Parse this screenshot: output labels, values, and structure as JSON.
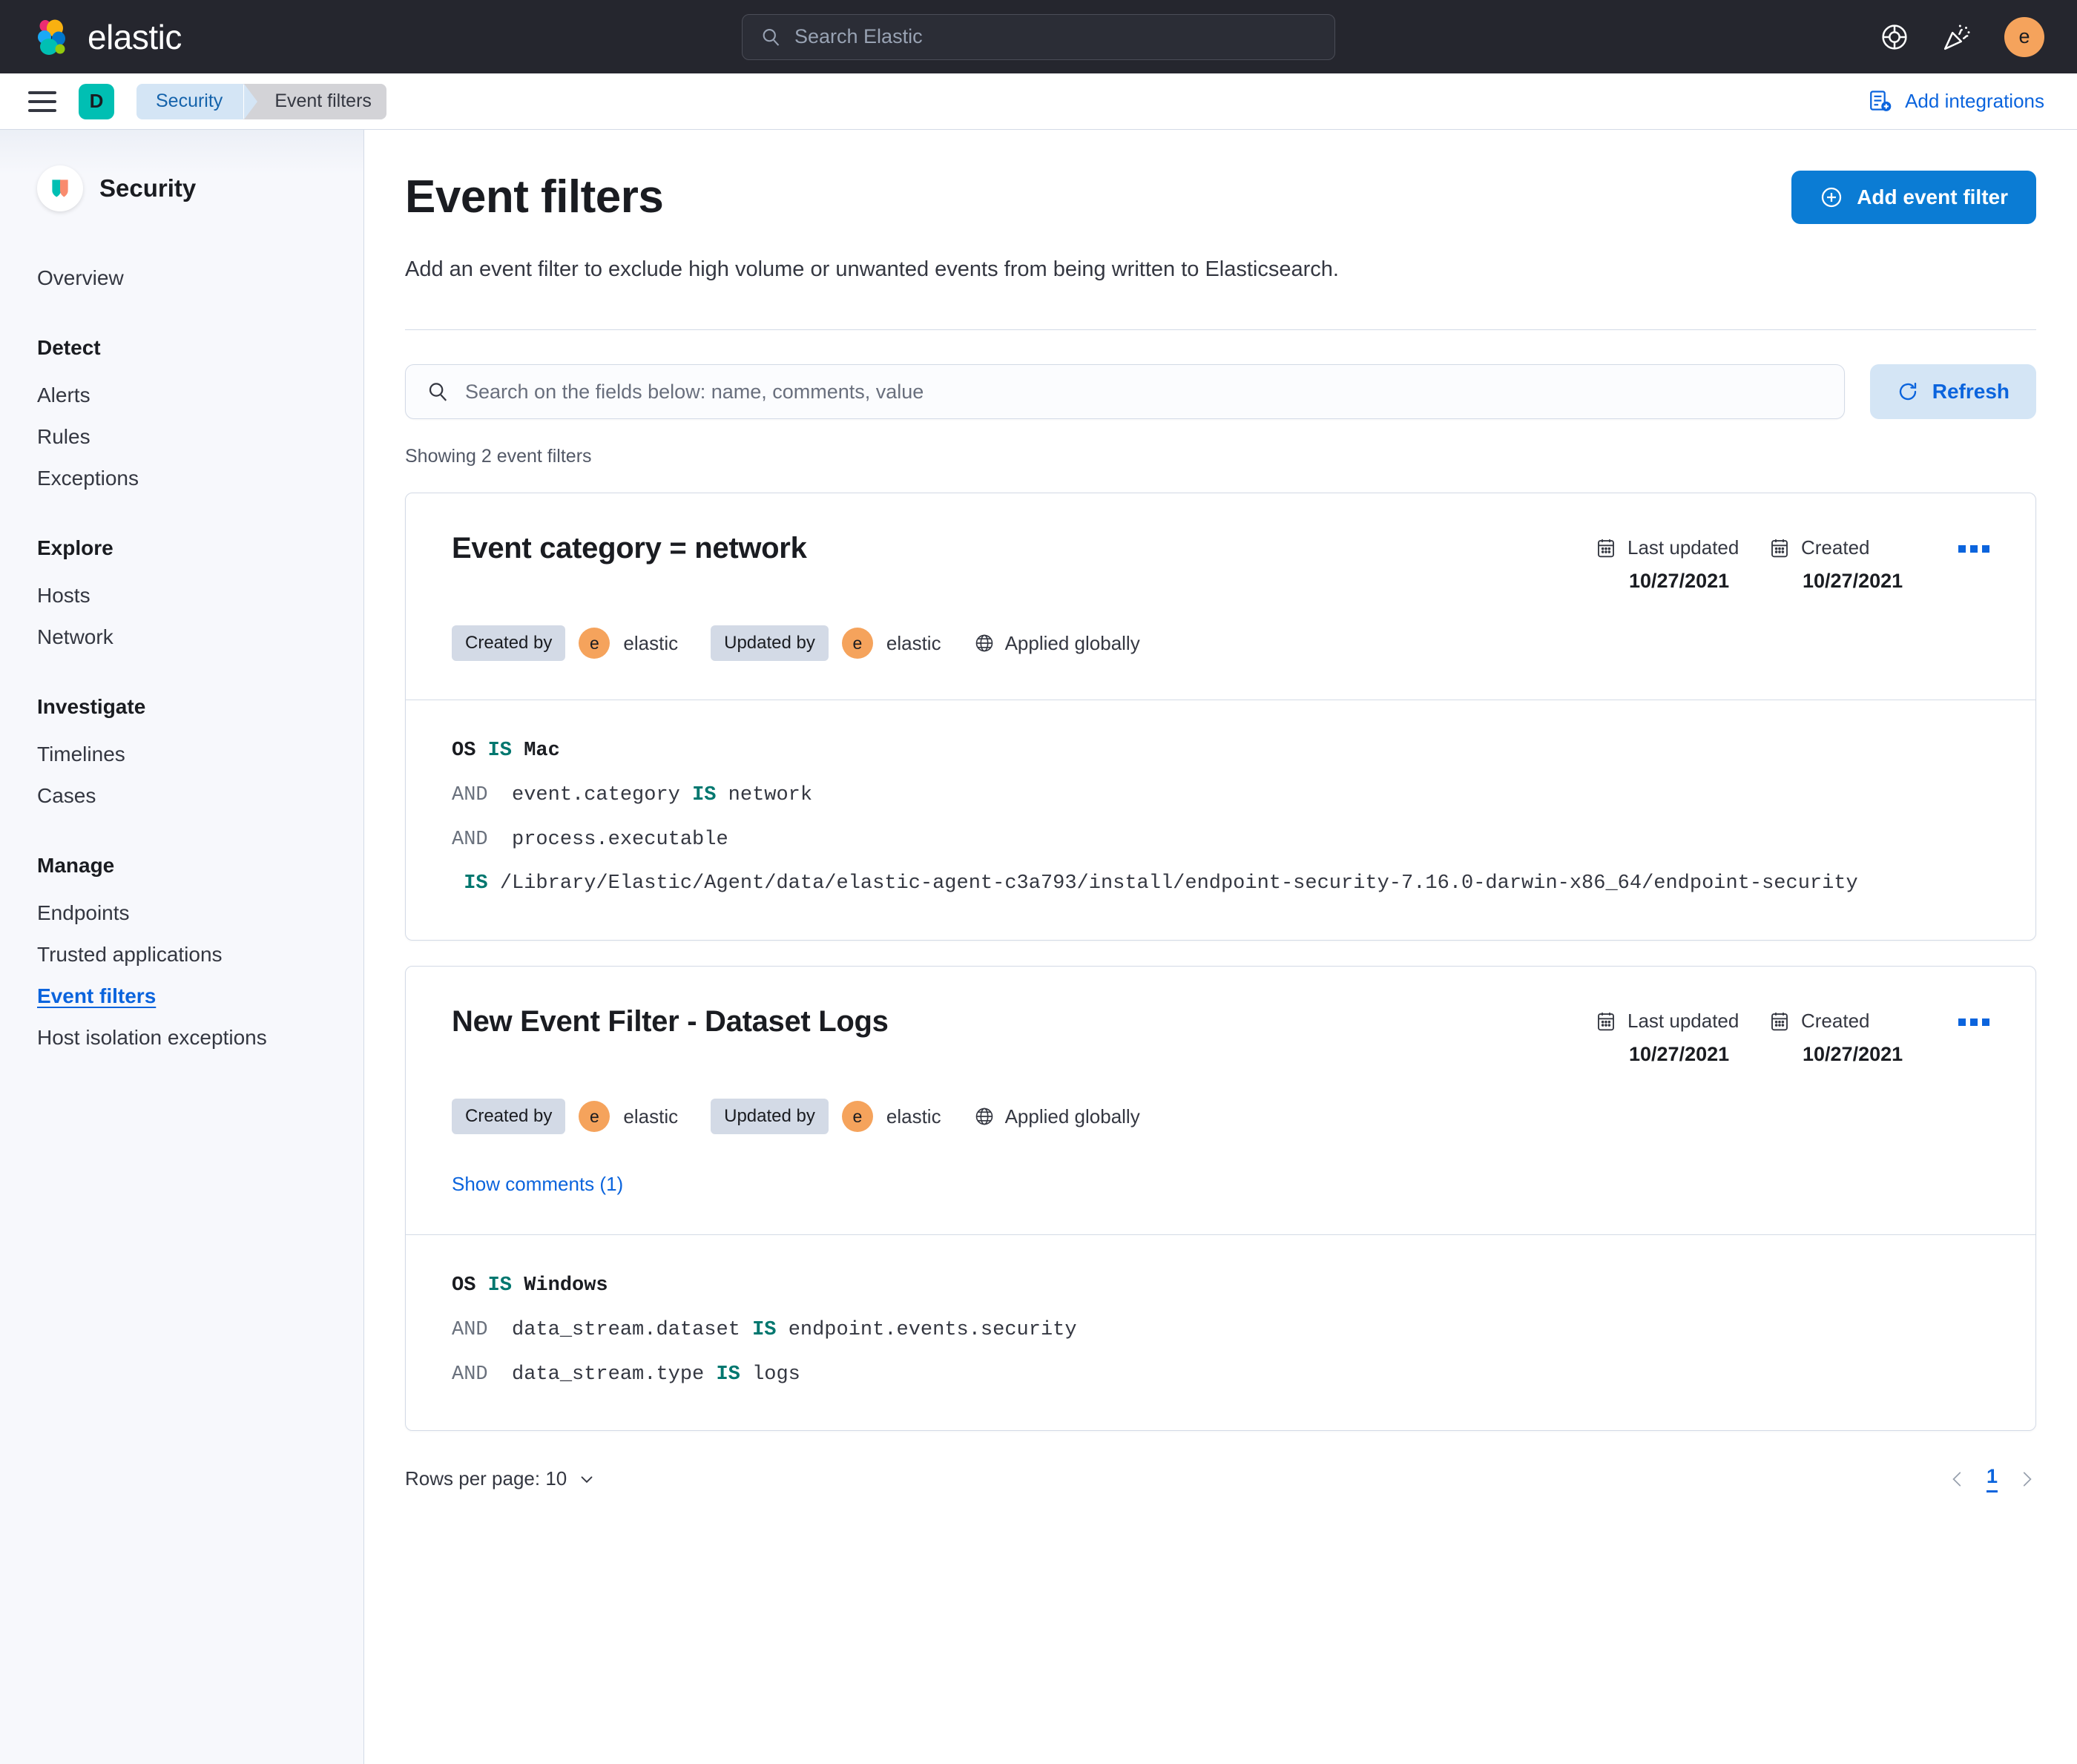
{
  "topbar": {
    "brand_name": "elastic",
    "brand_logo_icon": "elastic-logo-icon",
    "search": {
      "placeholder": "Search Elastic",
      "value": "",
      "icon": "search-icon"
    },
    "help_icon": "help-life-ring-icon",
    "whats_new_icon": "party-popper-icon",
    "avatar_initial": "e",
    "avatar_color": "#f5a35c"
  },
  "breadcrumb_bar": {
    "menu_icon": "hamburger-menu-icon",
    "space_initial": "D",
    "space_color": "#00bfb3",
    "crumbs": [
      {
        "label": "Security"
      },
      {
        "label": "Event filters"
      }
    ],
    "add_integrations": {
      "label": "Add integrations",
      "icon": "add-integrations-icon",
      "color": "#0b64dd"
    }
  },
  "sidebar": {
    "app_title": "Security",
    "app_icon": "security-shield-icon",
    "items": [
      {
        "label": "Overview",
        "type": "item",
        "active": false
      },
      {
        "label": "Detect",
        "type": "group"
      },
      {
        "label": "Alerts",
        "type": "item",
        "active": false
      },
      {
        "label": "Rules",
        "type": "item",
        "active": false
      },
      {
        "label": "Exceptions",
        "type": "item",
        "active": false
      },
      {
        "label": "Explore",
        "type": "group"
      },
      {
        "label": "Hosts",
        "type": "item",
        "active": false
      },
      {
        "label": "Network",
        "type": "item",
        "active": false
      },
      {
        "label": "Investigate",
        "type": "group"
      },
      {
        "label": "Timelines",
        "type": "item",
        "active": false
      },
      {
        "label": "Cases",
        "type": "item",
        "active": false
      },
      {
        "label": "Manage",
        "type": "group"
      },
      {
        "label": "Endpoints",
        "type": "item",
        "active": false
      },
      {
        "label": "Trusted applications",
        "type": "item",
        "active": false
      },
      {
        "label": "Event filters",
        "type": "item",
        "active": true
      },
      {
        "label": "Host isolation exceptions",
        "type": "item",
        "active": false
      }
    ]
  },
  "main": {
    "title": "Event filters",
    "description": "Add an event filter to exclude high volume or unwanted events from being written to Elasticsearch.",
    "add_button": {
      "label": "Add event filter",
      "icon": "plus-circle-icon",
      "color": "#0b7cd4"
    },
    "search": {
      "placeholder": "Search on the fields below: name, comments, value",
      "value": "",
      "icon": "search-icon"
    },
    "refresh_button": {
      "label": "Refresh",
      "icon": "refresh-icon",
      "color": "#0b64dd"
    },
    "showing": "Showing 2 event filters"
  },
  "cards": [
    {
      "title": "Event category = network",
      "created_by_label": "Created by",
      "created_by_user": "elastic",
      "created_by_initial": "e",
      "updated_by_label": "Updated by",
      "updated_by_user": "elastic",
      "updated_by_initial": "e",
      "applied_label": "Applied globally",
      "applied_icon": "globe-icon",
      "last_updated_label": "Last updated",
      "last_updated_value": "10/27/2021",
      "created_label": "Created",
      "created_value": "10/27/2021",
      "menu_icon": "more-actions-icon",
      "show_comments": null,
      "conditions": [
        {
          "and": "",
          "field": "OS",
          "op": "IS",
          "value": "Mac",
          "strong": true
        },
        {
          "and": "AND",
          "field": "event.category",
          "op": "IS",
          "value": "network",
          "strong": false
        },
        {
          "and": "AND",
          "field": "process.executable",
          "op": "",
          "value": "",
          "strong": false
        },
        {
          "and": "",
          "field": "",
          "op": "IS",
          "value": "/Library/Elastic/Agent/data/elastic-agent-c3a793/install/endpoint-security-7.16.0-darwin-x86_64/endpoint-security",
          "strong": false
        }
      ]
    },
    {
      "title": "New Event Filter - Dataset Logs",
      "created_by_label": "Created by",
      "created_by_user": "elastic",
      "created_by_initial": "e",
      "updated_by_label": "Updated by",
      "updated_by_user": "elastic",
      "updated_by_initial": "e",
      "applied_label": "Applied globally",
      "applied_icon": "globe-icon",
      "last_updated_label": "Last updated",
      "last_updated_value": "10/27/2021",
      "created_label": "Created",
      "created_value": "10/27/2021",
      "menu_icon": "more-actions-icon",
      "show_comments": "Show comments (1)",
      "conditions": [
        {
          "and": "",
          "field": "OS",
          "op": "IS",
          "value": "Windows",
          "strong": true
        },
        {
          "and": "AND",
          "field": "data_stream.dataset",
          "op": "IS",
          "value": "endpoint.events.security",
          "strong": false
        },
        {
          "and": "AND",
          "field": "data_stream.type",
          "op": "IS",
          "value": "logs",
          "strong": false
        }
      ]
    }
  ],
  "footer": {
    "rows_per_page": "Rows per page: 10",
    "rows_chevron_icon": "chevron-down-icon",
    "prev_icon": "chevron-left-icon",
    "next_icon": "chevron-right-icon",
    "current_page": "1"
  }
}
